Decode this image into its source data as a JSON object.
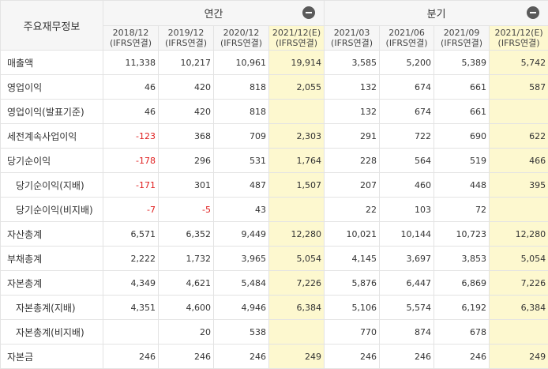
{
  "header": {
    "corner_label": "주요재무정보",
    "groups": [
      {
        "label": "연간",
        "toggle_icon": "minus-circle-icon"
      },
      {
        "label": "분기",
        "toggle_icon": "minus-circle-icon"
      }
    ],
    "periods": [
      {
        "date": "2018/12",
        "basis": "(IFRS연결)",
        "estimate": false
      },
      {
        "date": "2019/12",
        "basis": "(IFRS연결)",
        "estimate": false
      },
      {
        "date": "2020/12",
        "basis": "(IFRS연결)",
        "estimate": false
      },
      {
        "date": "2021/12(E)",
        "basis": "(IFRS연결)",
        "estimate": true
      },
      {
        "date": "2021/03",
        "basis": "(IFRS연결)",
        "estimate": false
      },
      {
        "date": "2021/06",
        "basis": "(IFRS연결)",
        "estimate": false
      },
      {
        "date": "2021/09",
        "basis": "(IFRS연결)",
        "estimate": false
      },
      {
        "date": "2021/12(E)",
        "basis": "(IFRS연결)",
        "estimate": true
      }
    ]
  },
  "rows": [
    {
      "label": "매출액",
      "sub": false,
      "values": [
        "11,338",
        "10,217",
        "10,961",
        "19,914",
        "3,585",
        "5,200",
        "5,389",
        "5,742"
      ]
    },
    {
      "label": "영업이익",
      "sub": false,
      "values": [
        "46",
        "420",
        "818",
        "2,055",
        "132",
        "674",
        "661",
        "587"
      ]
    },
    {
      "label": "영업이익(발표기준)",
      "sub": false,
      "values": [
        "46",
        "420",
        "818",
        "",
        "132",
        "674",
        "661",
        ""
      ]
    },
    {
      "label": "세전계속사업이익",
      "sub": false,
      "values": [
        "-123",
        "368",
        "709",
        "2,303",
        "291",
        "722",
        "690",
        "622"
      ]
    },
    {
      "label": "당기순이익",
      "sub": false,
      "values": [
        "-178",
        "296",
        "531",
        "1,764",
        "228",
        "564",
        "519",
        "466"
      ]
    },
    {
      "label": "당기순이익(지배)",
      "sub": true,
      "values": [
        "-171",
        "301",
        "487",
        "1,507",
        "207",
        "460",
        "448",
        "395"
      ]
    },
    {
      "label": "당기순이익(비지배)",
      "sub": true,
      "values": [
        "-7",
        "-5",
        "43",
        "",
        "22",
        "103",
        "72",
        ""
      ]
    },
    {
      "label": "자산총계",
      "sub": false,
      "values": [
        "6,571",
        "6,352",
        "9,449",
        "12,280",
        "10,021",
        "10,144",
        "10,723",
        "12,280"
      ]
    },
    {
      "label": "부채총계",
      "sub": false,
      "values": [
        "2,222",
        "1,732",
        "3,965",
        "5,054",
        "4,145",
        "3,697",
        "3,853",
        "5,054"
      ]
    },
    {
      "label": "자본총계",
      "sub": false,
      "values": [
        "4,349",
        "4,621",
        "5,484",
        "7,226",
        "5,876",
        "6,447",
        "6,869",
        "7,226"
      ]
    },
    {
      "label": "자본총계(지배)",
      "sub": true,
      "values": [
        "4,351",
        "4,600",
        "4,946",
        "6,384",
        "5,106",
        "5,574",
        "6,192",
        "6,384"
      ]
    },
    {
      "label": "자본총계(비지배)",
      "sub": true,
      "values": [
        "",
        "20",
        "538",
        "",
        "770",
        "874",
        "678",
        ""
      ]
    },
    {
      "label": "자본금",
      "sub": false,
      "values": [
        "246",
        "246",
        "246",
        "249",
        "246",
        "246",
        "246",
        "249"
      ]
    }
  ],
  "colors": {
    "estimate_bg": "#fdf8cf",
    "negative": "#e02020",
    "header_bg": "#f6f6f6",
    "border": "#e3e3e3"
  }
}
